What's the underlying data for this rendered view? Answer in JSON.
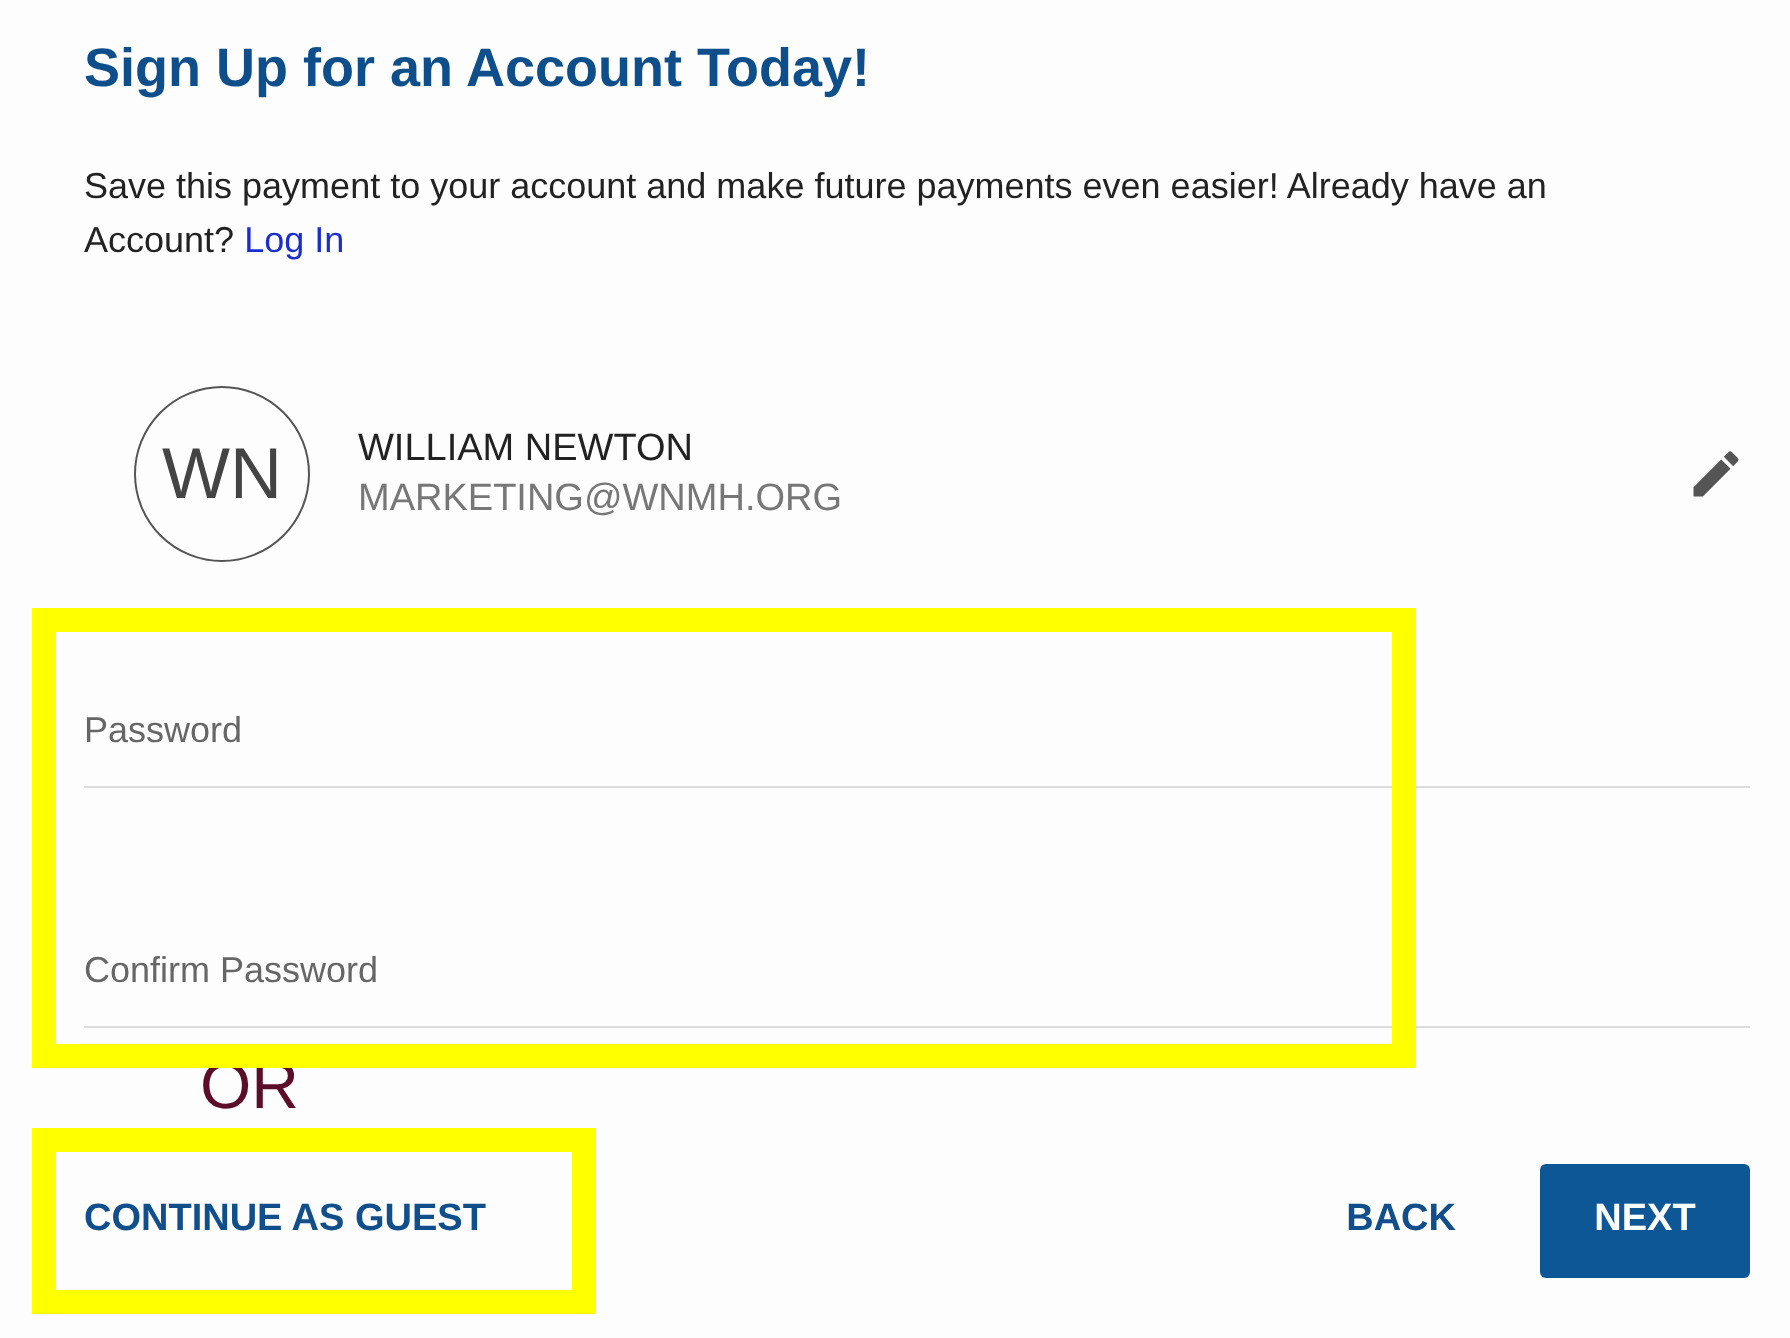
{
  "title": "Sign Up for an Account Today!",
  "intro": {
    "text": "Save this payment to your account and make future payments even easier! Already have an Account?",
    "link": "Log In"
  },
  "user": {
    "initials": "WN",
    "name": "WILLIAM NEWTON",
    "email": "MARKETING@WNMH.ORG"
  },
  "password_fields": {
    "highlighted": true,
    "fields": [
      {
        "placeholder": "Password"
      },
      {
        "placeholder": "Confirm Password"
      }
    ]
  },
  "separator": "OR",
  "guest_button": {
    "label": "CONTINUE AS GUEST",
    "highlighted": true
  },
  "buttons": [
    {
      "label": "BACK",
      "kind": "text"
    },
    {
      "label": "NEXT",
      "kind": "primary"
    }
  ]
}
